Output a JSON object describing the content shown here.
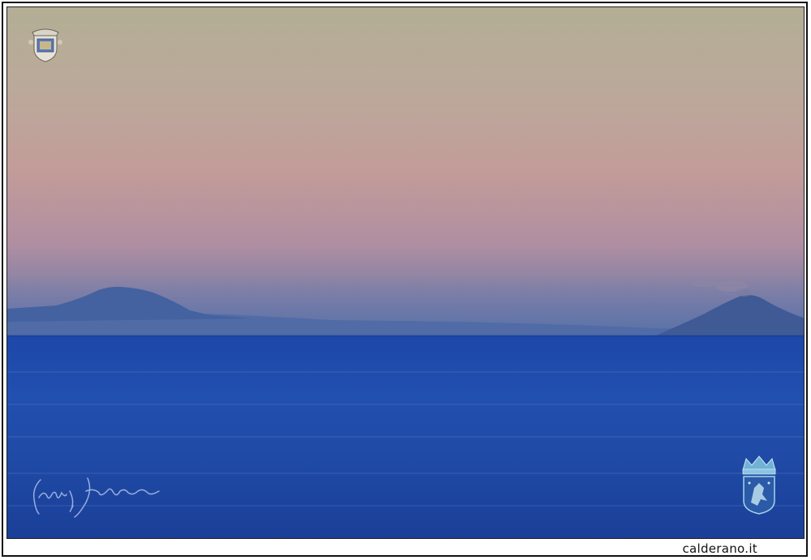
{
  "watermark": {
    "site": "calderano.it"
  },
  "icons": {
    "top_left": "coat-of-arms-icon",
    "bottom_right": "crowned-shield-icon",
    "signature": "handwritten-signature"
  },
  "colors": {
    "sky_top": "#b5ae94",
    "sky_mid": "#c09a98",
    "sky_low": "#7f7aa2",
    "sea": "#1f4aa6",
    "island": "#3f5f9a",
    "frame": "#111111"
  }
}
